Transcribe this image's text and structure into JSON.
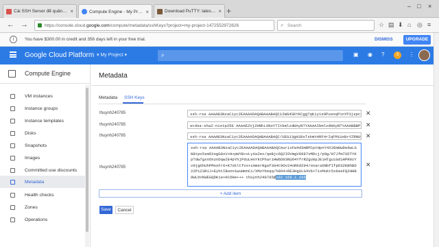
{
  "browser": {
    "tabs": [
      {
        "title": "Cài SSH Server để quản trị ...",
        "favicon_color": "#d9534f"
      },
      {
        "title": "Compute Engine - My Pro...",
        "favicon_color": "#4285f4"
      },
      {
        "title": "Download PuTTY: latest re...",
        "favicon_color": "#7b5a3c"
      }
    ],
    "new_tab": "+",
    "url_prefix": "https://console.cloud.",
    "url_host": "google.com",
    "url_path": "/compute/metadata/sshKeys?project=my-project-1472552972826",
    "search_placeholder": "Search"
  },
  "trial": {
    "message": "You have $300.00 in credit and 356 days left in your free trial.",
    "dismiss": "DISMISS",
    "upgrade": "UPGRADE"
  },
  "gcp": {
    "title": "Google Cloud Platform",
    "project": "▾ My Project ▾",
    "notification_count": "3"
  },
  "sidebar": {
    "title": "Compute Engine",
    "items": [
      {
        "label": "VM instances"
      },
      {
        "label": "Instance groups"
      },
      {
        "label": "Instance templates"
      },
      {
        "label": "Disks"
      },
      {
        "label": "Snapshots"
      },
      {
        "label": "Images"
      },
      {
        "label": "Committed use discounts"
      },
      {
        "label": "Metadata"
      },
      {
        "label": "Health checks"
      },
      {
        "label": "Zones"
      },
      {
        "label": "Operations"
      }
    ]
  },
  "main": {
    "title": "Metadata",
    "tabs": [
      "Metadata",
      "SSH Keys"
    ],
    "keys": [
      {
        "user": "thuynh240785",
        "key": "ssh-rsa AAAAB3NzaC1yc2EAAAADAQABAAABAQC12WG4SKYKCggTqKiy1s9PusnqP1nYP3jspc5axoRPkOZ"
      },
      {
        "user": "thuynh240785",
        "key": "ecdsa-sha2-nistp256 AAAAE2VjZHNhLXNoYTItbmlzdHAyNTYAAAAIbmlzdHAyNTYAAABBBPIErIfaA"
      },
      {
        "user": "thuynh240785",
        "key": "ssh-rsa AAAAB3NzaC1yc2EAAAADAQABAAABAQC/UEG13gH38sTskmV4RF4rIqFMiUsB+YZRNUB6cdyatc"
      }
    ],
    "new_key_user": "thuynh240785",
    "new_key_text": "ssh-rsa AAAAB3NzaC1yc2EAAAADAQABAAABAQCAurixFw4d3mRPCptHpnY4X36mHwDedwLGN8tpx5sm5XogG0xV+H+pWYB+vLyXeZex/qeBjc6Q2IOVmgV9687vMDcj/p9g/H7Jfm7XDTYKpTdw7gxXOnznDqwIE4pYhjPduLHnYkCPhariHW6D93NUO4YfrRZgu0pJEiHTgu1Gd1HPR9zYv9jg6hUhPMoxFr6+K7okltfvx+zAmerNgaf3G4t9Ov24nRKd294/onara6NbfIfpD32KBhBD22Pi23RiJ+EyhtIBonn1wuHmnCi/XMzYbeqq/h8O4+RE3HgULG4V6+TixMukt5x9asFQ2HHB8WLbVKWEGQDKie+KCOHe+++ thuynh240785@",
    "new_key_selected": "192.168.1.106",
    "add_item": "+ Add item",
    "save": "Save",
    "cancel": "Cancel"
  }
}
